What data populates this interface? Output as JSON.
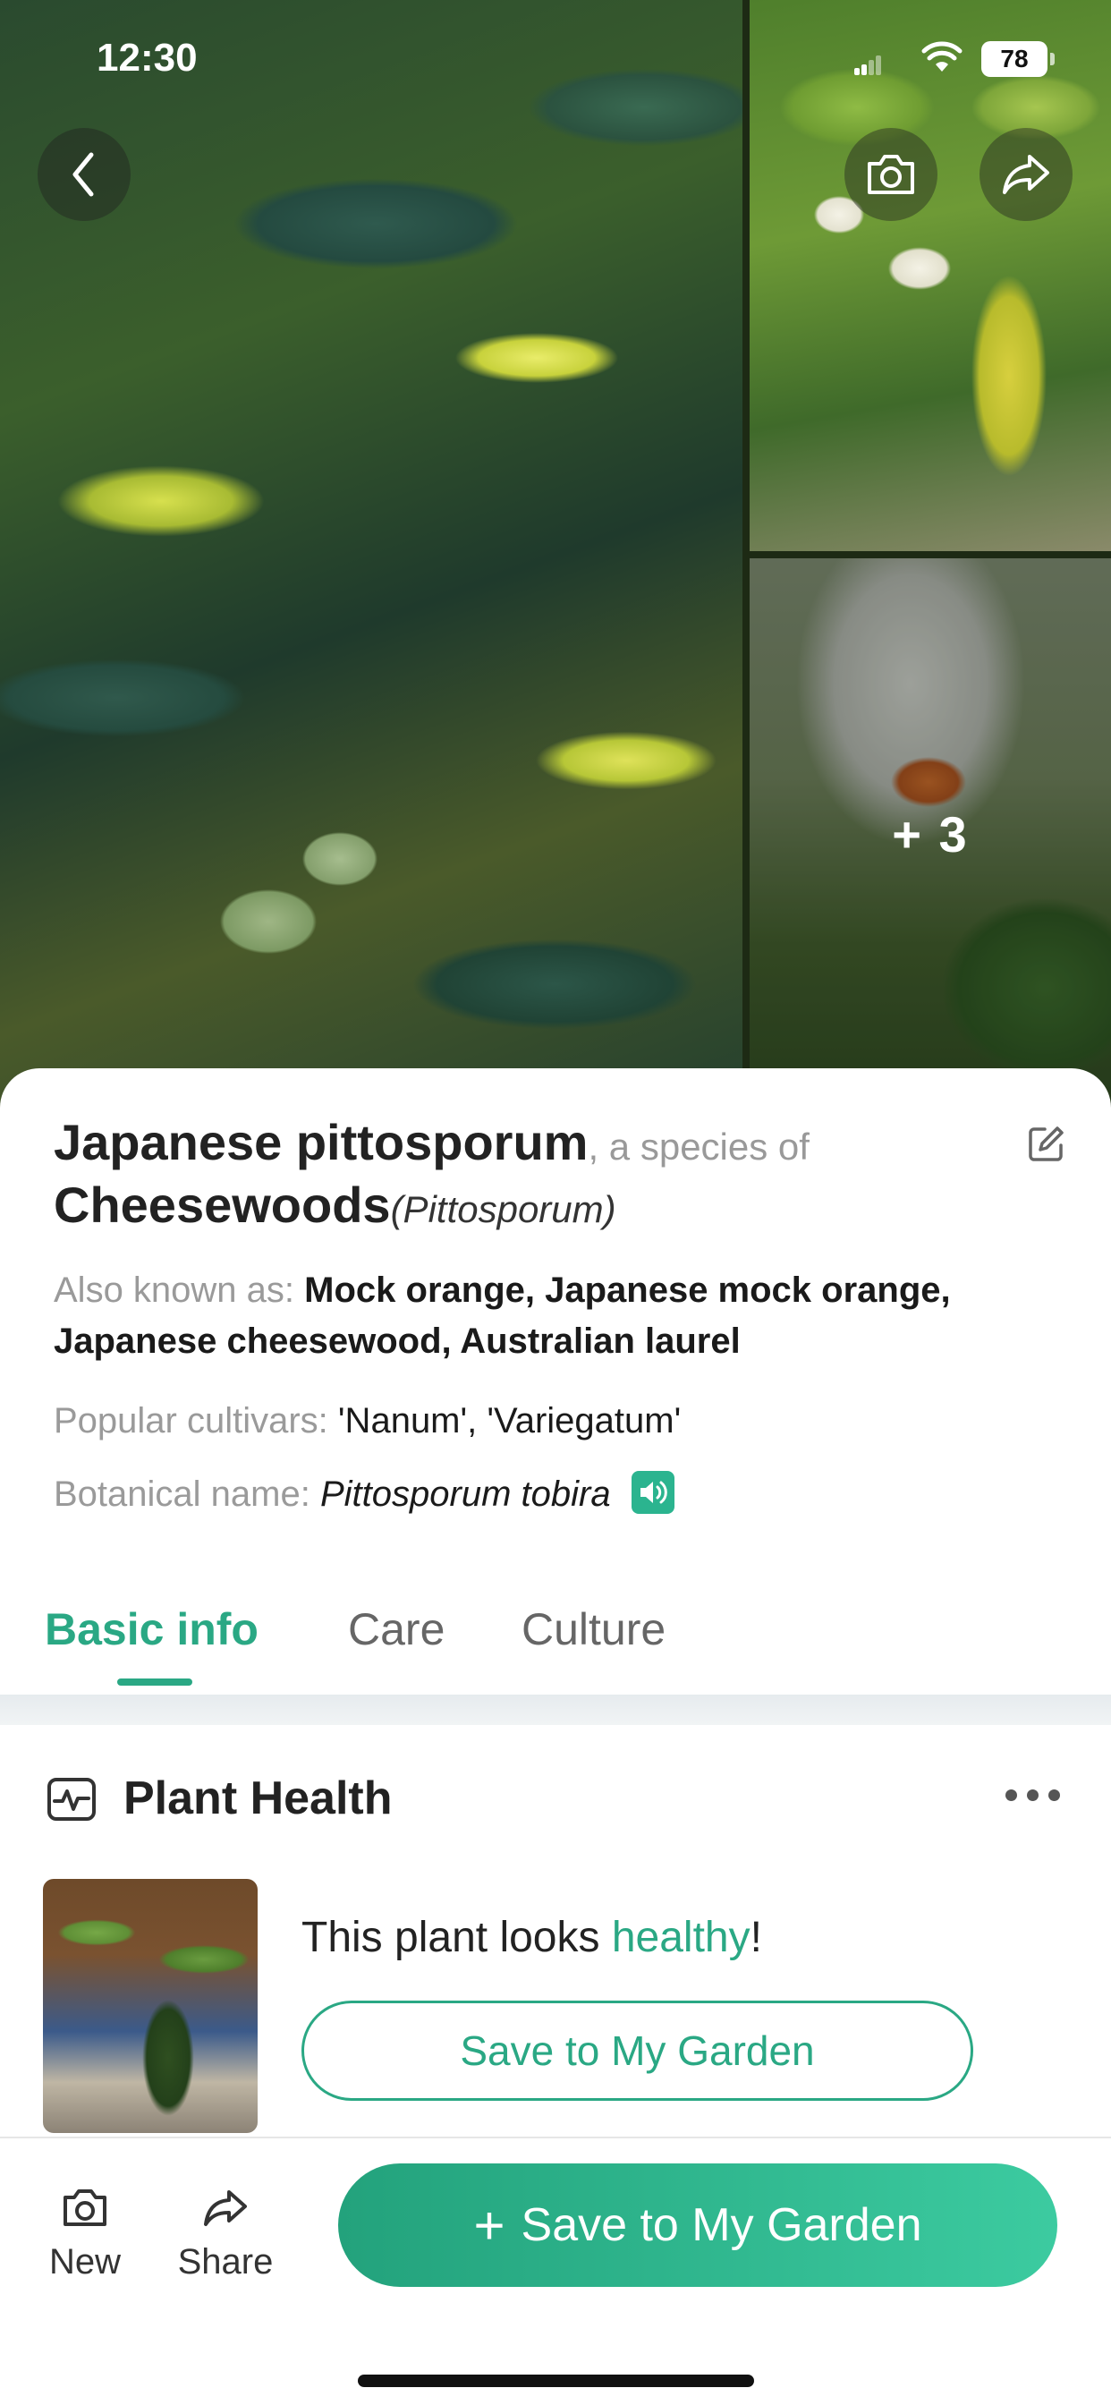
{
  "status_bar": {
    "time": "12:30",
    "battery": "78"
  },
  "gallery": {
    "more_count": "+ 3"
  },
  "plant": {
    "common_name": "Japanese pittosporum",
    "species_of_text": ", a species of",
    "genus_name": "Cheesewoods",
    "genus_latin": "(Pittosporum)",
    "aka_label": "Also known as:",
    "aka_value": "Mock orange, Japanese mock orange, Japanese cheesewood, Australian laurel",
    "cultivars_label": "Popular cultivars:",
    "cultivars_value": "'Nanum', 'Variegatum'",
    "botanical_label": "Botanical name:",
    "botanical_value": "Pittosporum tobira"
  },
  "tabs": [
    {
      "label": "Basic info",
      "active": true
    },
    {
      "label": "Care",
      "active": false
    },
    {
      "label": "Culture",
      "active": false
    }
  ],
  "health": {
    "title": "Plant Health",
    "status_prefix": "This plant looks ",
    "status_word": "healthy",
    "status_suffix": "!",
    "save_button": "Save to My Garden"
  },
  "bottom_bar": {
    "new_label": "New",
    "share_label": "Share",
    "primary_button": "Save to My Garden",
    "primary_icon": "+"
  },
  "colors": {
    "accent": "#2aa884",
    "accent_light": "#3ccba0"
  }
}
